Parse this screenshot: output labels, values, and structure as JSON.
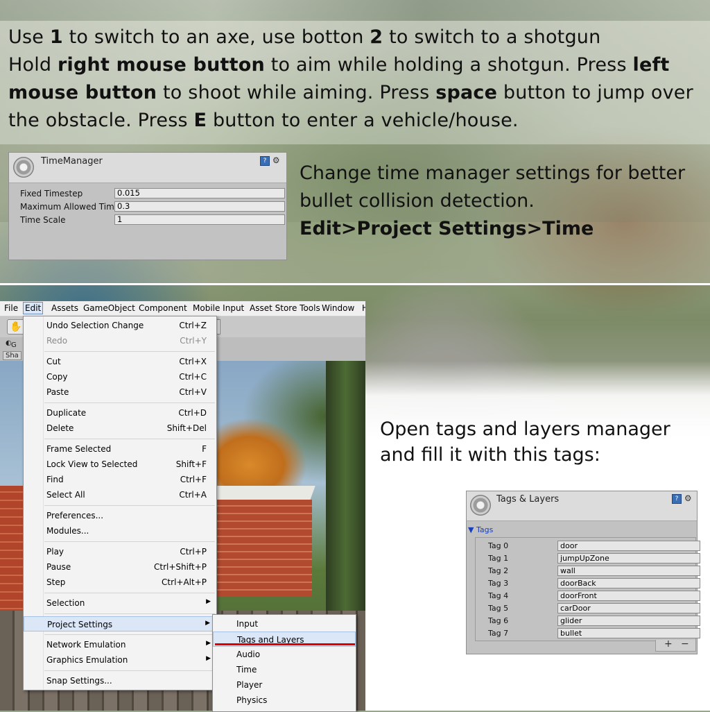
{
  "intro": {
    "line1": {
      "a": "Use ",
      "b": "1",
      "c": " to switch to an axe, use botton ",
      "d": "2",
      "e": " to switch to a shotgun"
    },
    "line2": {
      "a": "Hold ",
      "b": "right mouse button",
      "c": " to aim while holding a shotgun. Press ",
      "d": "left"
    },
    "line3": {
      "b": "mouse button",
      "c": " to shoot while aiming. Press ",
      "d": "space",
      "e": " button to jump over"
    },
    "line4": {
      "a": "the obstacle. Press ",
      "b": "E",
      "c": " button to enter a vehicle/house."
    }
  },
  "time_manager": {
    "title": "TimeManager",
    "rows": [
      {
        "label": "Fixed Timestep",
        "value": "0.015"
      },
      {
        "label": "Maximum Allowed Tim",
        "value": "0.3"
      },
      {
        "label": "Time Scale",
        "value": "1"
      }
    ],
    "help_icon": "help-book-icon",
    "settings_icon": "gear-small-icon"
  },
  "time_note": {
    "line1": "Change time manager settings for better",
    "line2": "bullet collision detection.",
    "path": "Edit>Project Settings>Time"
  },
  "menubar": [
    "File",
    "Edit",
    "Assets",
    "GameObject",
    "Component",
    "Mobile Input",
    "Asset Store Tools",
    "Window",
    "H"
  ],
  "toolbar": {
    "g_label": "G",
    "tab_label": "Sha"
  },
  "edit_menu": [
    {
      "label": "Undo Selection Change",
      "shortcut": "Ctrl+Z"
    },
    {
      "label": "Redo",
      "shortcut": "Ctrl+Y",
      "disabled": true
    },
    {
      "label": "Cut",
      "shortcut": "Ctrl+X"
    },
    {
      "label": "Copy",
      "shortcut": "Ctrl+C"
    },
    {
      "label": "Paste",
      "shortcut": "Ctrl+V"
    },
    {
      "label": "Duplicate",
      "shortcut": "Ctrl+D"
    },
    {
      "label": "Delete",
      "shortcut": "Shift+Del"
    },
    {
      "label": "Frame Selected",
      "shortcut": "F"
    },
    {
      "label": "Lock View to Selected",
      "shortcut": "Shift+F"
    },
    {
      "label": "Find",
      "shortcut": "Ctrl+F"
    },
    {
      "label": "Select All",
      "shortcut": "Ctrl+A"
    },
    {
      "label": "Preferences...",
      "shortcut": ""
    },
    {
      "label": "Modules...",
      "shortcut": ""
    },
    {
      "label": "Play",
      "shortcut": "Ctrl+P"
    },
    {
      "label": "Pause",
      "shortcut": "Ctrl+Shift+P"
    },
    {
      "label": "Step",
      "shortcut": "Ctrl+Alt+P"
    },
    {
      "label": "Selection",
      "shortcut": ""
    },
    {
      "label": "Project Settings",
      "shortcut": ""
    },
    {
      "label": "Network Emulation",
      "shortcut": ""
    },
    {
      "label": "Graphics Emulation",
      "shortcut": ""
    },
    {
      "label": "Snap Settings...",
      "shortcut": ""
    }
  ],
  "project_settings_submenu": [
    "Input",
    "Tags and Layers",
    "Audio",
    "Time",
    "Player",
    "Physics"
  ],
  "tags_note": {
    "line1": "Open tags and layers manager",
    "line2": "and fill it with this tags:"
  },
  "tags_layers": {
    "title": "Tags & Layers",
    "section": "Tags",
    "rows": [
      {
        "label": "Tag 0",
        "value": "door"
      },
      {
        "label": "Tag 1",
        "value": "jumpUpZone"
      },
      {
        "label": "Tag 2",
        "value": "wall"
      },
      {
        "label": "Tag 3",
        "value": "doorBack"
      },
      {
        "label": "Tag 4",
        "value": "doorFront"
      },
      {
        "label": "Tag 5",
        "value": "carDoor"
      },
      {
        "label": "Tag 6",
        "value": "glider"
      },
      {
        "label": "Tag 7",
        "value": "bullet"
      }
    ],
    "add": "+",
    "remove": "−"
  }
}
